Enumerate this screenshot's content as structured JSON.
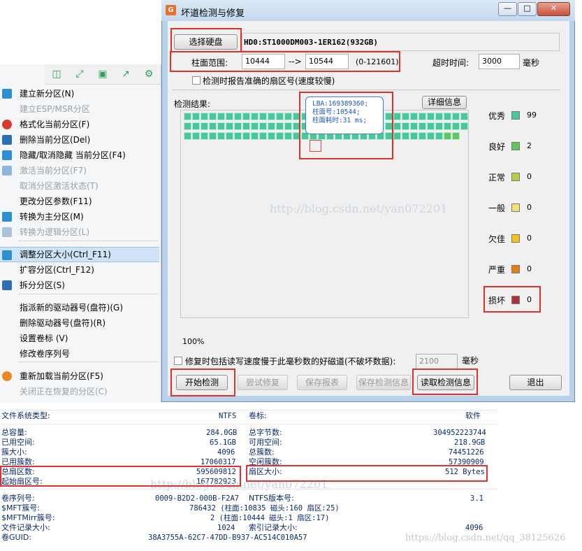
{
  "menu": {
    "toolbar_icons": [
      "window-icon",
      "expand-icon",
      "save-icon",
      "share-icon",
      "settings-icon"
    ],
    "items": [
      {
        "label": "建立新分区(N)",
        "enabled": true,
        "icon": "create-partition-icon"
      },
      {
        "label": "建立ESP/MSR分区",
        "enabled": false,
        "icon": ""
      },
      {
        "label": "格式化当前分区(F)",
        "enabled": true,
        "icon": "format-icon"
      },
      {
        "label": "删除当前分区(Del)",
        "enabled": true,
        "icon": "delete-icon"
      },
      {
        "label": "隐藏/取消隐藏 当前分区(F4)",
        "enabled": true,
        "icon": "hide-icon"
      },
      {
        "label": "激活当前分区(F7)",
        "enabled": false,
        "icon": "activate-icon"
      },
      {
        "label": "取消分区激活状态(T)",
        "enabled": false,
        "icon": ""
      },
      {
        "label": "更改分区参数(F11)",
        "enabled": true,
        "icon": ""
      },
      {
        "label": "转换为主分区(M)",
        "enabled": true,
        "icon": "to-primary-icon"
      },
      {
        "label": "转换为逻辑分区(L)",
        "enabled": false,
        "icon": "to-logical-icon"
      },
      {
        "label": "调整分区大小(Ctrl_F11)",
        "enabled": true,
        "icon": "resize-icon"
      },
      {
        "label": "扩容分区(Ctrl_F12)",
        "enabled": true,
        "icon": ""
      },
      {
        "label": "拆分分区(S)",
        "enabled": true,
        "icon": "split-icon"
      },
      {
        "label": "指派新的驱动器号(盘符)(G)",
        "enabled": true,
        "icon": ""
      },
      {
        "label": "删除驱动器号(盘符)(R)",
        "enabled": true,
        "icon": ""
      },
      {
        "label": "设置卷标 (V)",
        "enabled": true,
        "icon": ""
      },
      {
        "label": "修改卷序列号",
        "enabled": true,
        "icon": ""
      },
      {
        "label": "重新加载当前分区(F5)",
        "enabled": true,
        "icon": "reload-icon"
      },
      {
        "label": "关闭正在恢复的分区(C)",
        "enabled": false,
        "icon": ""
      }
    ]
  },
  "dialog": {
    "title": "坏道检测与修复",
    "select_disk_label": "选择硬盘",
    "disk_name": "HD0:ST1000DM003-1ER162(932GB)",
    "cyl_range_label": "柱面范围:",
    "cyl_from": "10444",
    "cyl_arrow": "-->",
    "cyl_to": "10544",
    "cyl_limits": "(0-121601)",
    "timeout_label": "超时时间:",
    "timeout_value": "3000",
    "timeout_unit": "毫秒",
    "report_sector_label": "检测时报告准确的扇区号(速度较慢)",
    "results_label": "检测结果:",
    "details_button": "详细信息",
    "tooltip": {
      "lba": "LBA:169389360;",
      "cyl": "柱面号:10544;",
      "time": "柱面耗时:31 ms;"
    },
    "progress": "100%",
    "repair_option_label": "修复时包括读写速度慢于此毫秒数的好磁道(不破坏数据):",
    "repair_ms": "2100",
    "repair_unit": "毫秒",
    "buttons": {
      "start": "开始检测",
      "try_repair": "尝试修复",
      "save_report": "保存报表",
      "save_info": "保存检测信息",
      "read_info": "读取检测信息",
      "exit": "退出"
    },
    "watermark": "http://blog.csdn.net/yan072201",
    "good_cells": 99,
    "fair_cells": 2,
    "legend": [
      {
        "label": "优秀",
        "count": "99",
        "color": "#46c89a"
      },
      {
        "label": "良好",
        "count": "2",
        "color": "#5ec85e"
      },
      {
        "label": "正常",
        "count": "0",
        "color": "#b3cf45"
      },
      {
        "label": "一般",
        "count": "0",
        "color": "#f3e07a"
      },
      {
        "label": "欠佳",
        "count": "0",
        "color": "#f4c21a"
      },
      {
        "label": "严重",
        "count": "0",
        "color": "#e47d14"
      },
      {
        "label": "损坏",
        "count": "0",
        "color": "#b0333b"
      }
    ]
  },
  "info": {
    "fs_type_label": "文件系统类型:",
    "fs_type": "NTFS",
    "volume_label_label": "卷标:",
    "volume_label": "软件",
    "total_capacity_label": "总容量:",
    "total_capacity": "284.0GB",
    "total_bytes_label": "总字节数:",
    "total_bytes": "304952223744",
    "used_label": "已用空间:",
    "used": "65.1GB",
    "free_label": "可用空间:",
    "free": "218.9GB",
    "cluster_size_label": "簇大小:",
    "cluster_size": "4096",
    "total_clusters_label": "总簇数:",
    "total_clusters": "74451226",
    "used_clusters_label": "已用簇数:",
    "used_clusters": "17060317",
    "free_clusters_label": "空闲簇数:",
    "free_clusters": "57390909",
    "total_sectors_label": "总扇区数:",
    "total_sectors": "595609812",
    "sector_size_label": "扇区大小:",
    "sector_size": "512 Bytes",
    "start_sector_label": "起始扇区号:",
    "start_sector": "167782923",
    "serial_label": "卷序列号:",
    "serial": "0009-B2D2-000B-F2A7",
    "ntfs_ver_label": "NTFS版本号:",
    "ntfs_ver": "3.1",
    "mft_label": "$MFT簇号:",
    "mft": "786432 (柱面:10835 磁头:160 扇区:25)",
    "mftmirr_label": "$MFTMirr簇号:",
    "mftmirr": "2 (柱面:10444 磁头:1 扇区:17)",
    "record_size_label": "文件记录大小:",
    "record_size": "1024",
    "index_size_label": "索引记录大小:",
    "index_size": "4096",
    "guid_label": "卷GUID:",
    "guid": "38A3755A-62C7-47DD-B937-AC514C010A57",
    "watermark_1": "http://blog.csdn.net/yan072201",
    "watermark_2": "https://blog.csdn.net/qq_38125626"
  }
}
